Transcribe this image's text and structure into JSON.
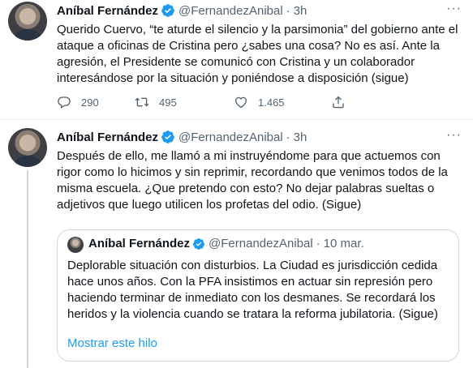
{
  "tweet1": {
    "name": "Aníbal Fernández",
    "handle": "@FernandezAnibal",
    "separator": "·",
    "time": "3h",
    "text": "Querido Cuervo, “te aturde el silencio y la parsimonia” del gobierno ante el ataque a oficinas de Cristina pero ¿sabes una cosa? No es así. Ante la agresión, el Presidente se comunicó con Cristina y un colaborador interesándose por la situación y poniéndose a disposición (sigue)",
    "replies": "290",
    "retweets": "495",
    "likes": "1.465"
  },
  "tweet2": {
    "name": "Aníbal Fernández",
    "handle": "@FernandezAnibal",
    "separator": "·",
    "time": "3h",
    "text": "Después de ello, me llamó a mi instruyéndome para que actuemos con rigor como lo hicimos y sin reprimir, recordando que venimos todos de la misma escuela. ¿Que pretendo con esto? No dejar palabras sueltas o adjetivos que luego utilicen los profetas del odio. (Sigue)",
    "quote": {
      "name": "Aníbal Fernández",
      "handle": "@FernandezAnibal",
      "separator": "·",
      "time": "10 mar.",
      "text": "Deplorable situación con disturbios. La Ciudad es jurisdicción cedida hace unos años. Con la PFA insistimos en actuar sin represión pero haciendo terminar de inmediato con los desmanes. Se recordará los heridos y la violencia cuando se tratara la reforma jubilatoria. (Sigue)",
      "show_thread": "Mostrar este hilo"
    }
  },
  "icons": {
    "verified": "verified-badge-icon",
    "more": "more-dots-icon",
    "reply": "reply-icon",
    "retweet": "retweet-icon",
    "like": "heart-icon",
    "share": "share-icon"
  },
  "colors": {
    "accent": "#1d9bf0",
    "secondary_text": "#536471",
    "border": "#cfd9de"
  }
}
